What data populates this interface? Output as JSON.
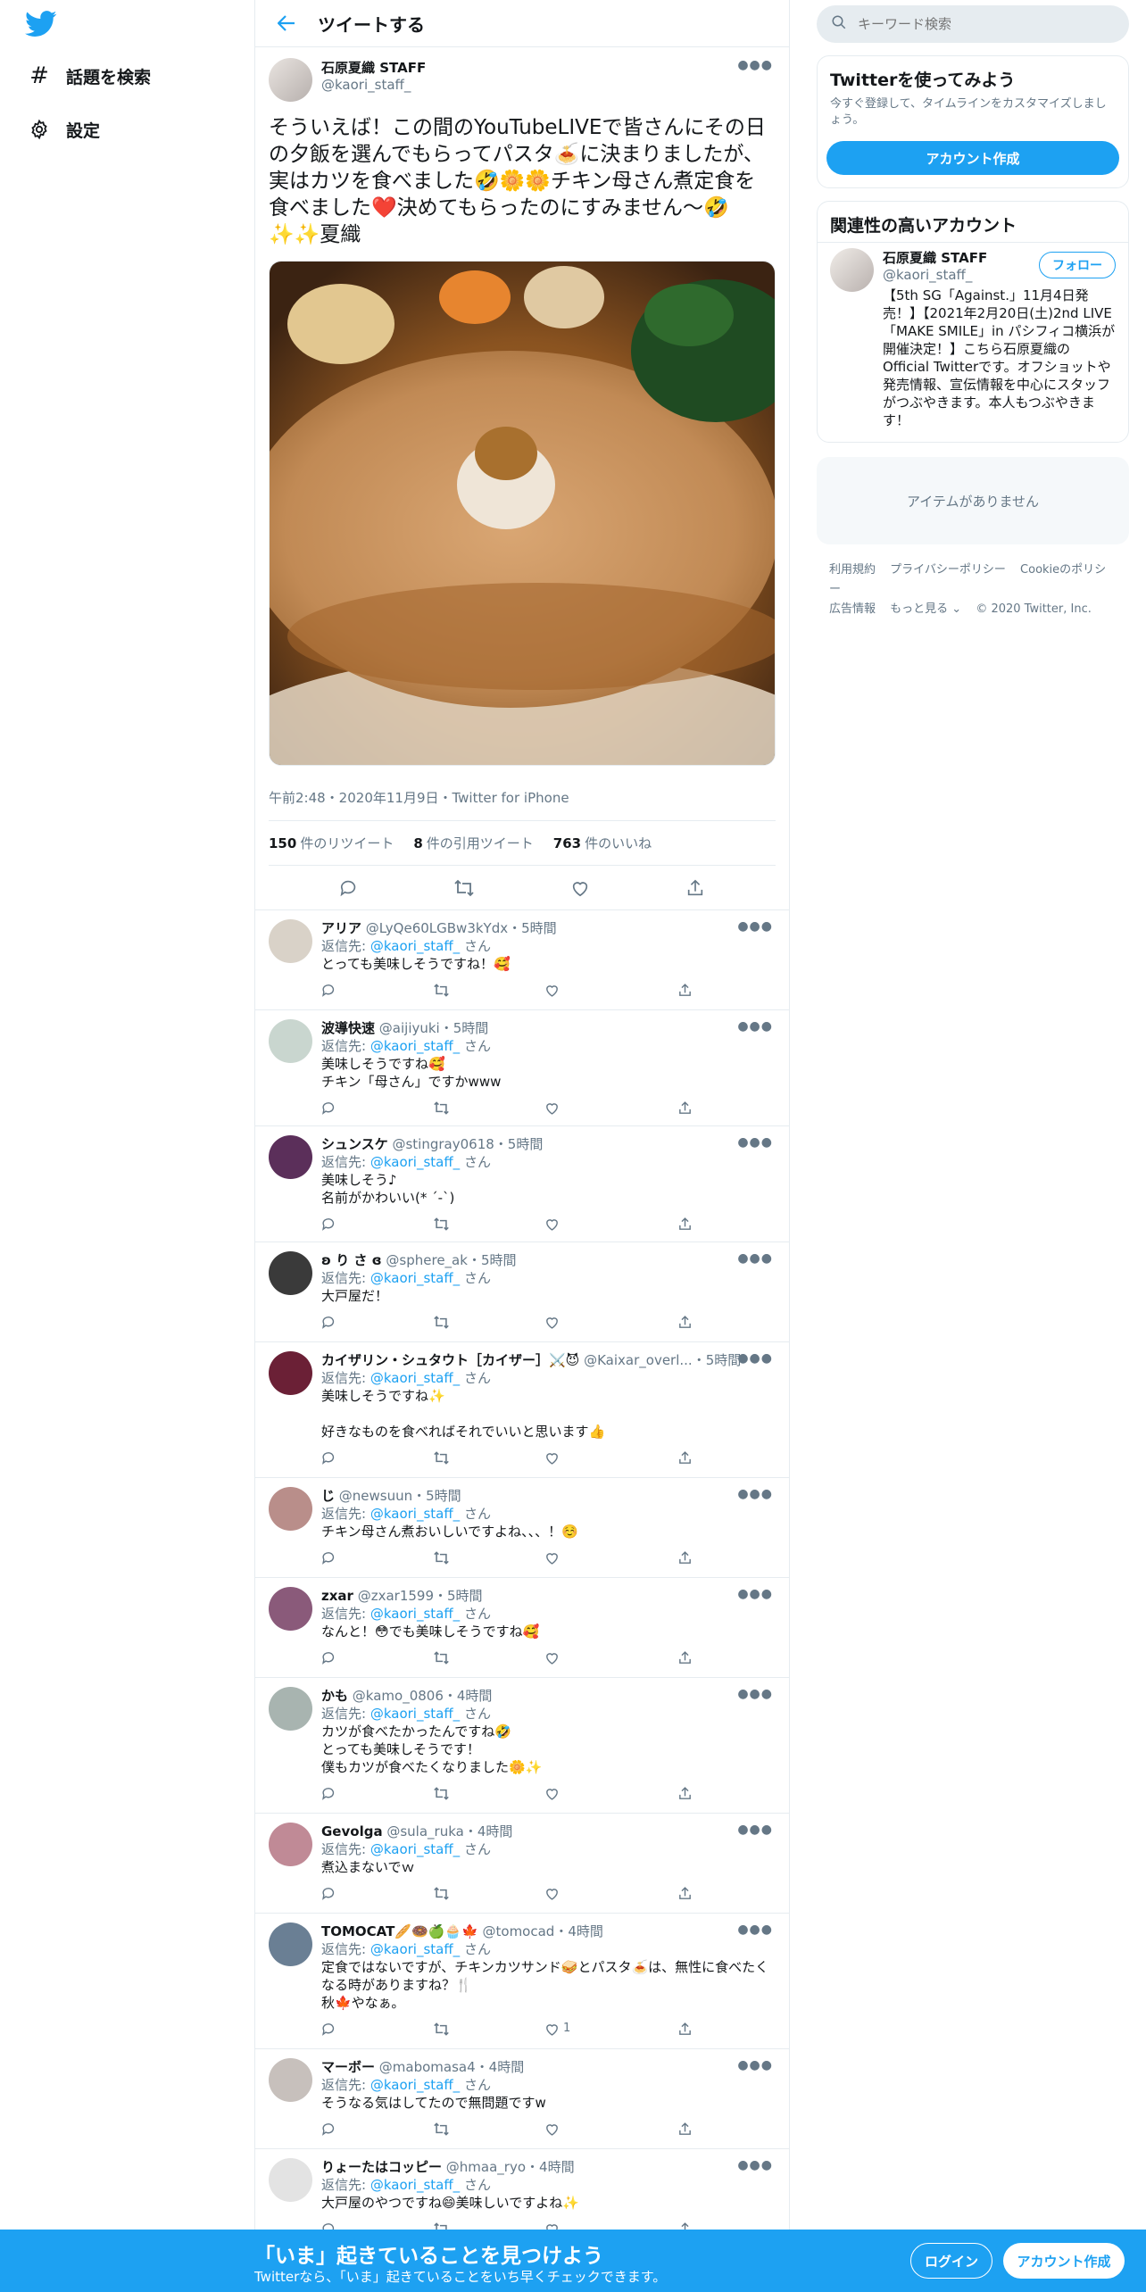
{
  "nav": {
    "items": [
      {
        "label": "話題を検索",
        "icon": "hashtag-icon"
      },
      {
        "label": "設定",
        "icon": "gear-icon"
      }
    ]
  },
  "header": {
    "title": "ツイートする"
  },
  "tweet": {
    "display_name": "石原夏織 STAFF",
    "username": "@kaori_staff_",
    "text": "そういえば！この間のYouTubeLIVEで皆さんにその日の夕飯を選んでもらってパスタ🍝に決まりましたが、実はカツを食べました🤣🌼🌼チキン母さん煮定食を食べました❤️決めてもらったのにすみません〜🤣✨✨夏織",
    "meta": "午前2:48・2020年11月9日・Twitter for iPhone",
    "retweets": "150",
    "retweets_label": "件のリツイート",
    "quotes": "8",
    "quotes_label": "件の引用ツイート",
    "likes": "763",
    "likes_label": "件のいいね"
  },
  "reply_prefix": "返信先: ",
  "reply_suffix": " さん",
  "replies": [
    {
      "name": "アリア",
      "handle": "@LyQe60LGBw3kYdx",
      "time": "・5時間",
      "to": "@kaori_staff_",
      "text": "とっても美味しそうですね！🥰",
      "likes": "",
      "avatar": "#d9d2c8"
    },
    {
      "name": "波導快速",
      "handle": "@aijiyuki",
      "time": "・5時間",
      "to": "@kaori_staff_",
      "text": "美味しそうですね🥰\nチキン「母さん」ですかwww",
      "likes": "",
      "avatar": "#c9d6cf"
    },
    {
      "name": "シュンスケ",
      "handle": "@stingray0618",
      "time": "・5時間",
      "to": "@kaori_staff_",
      "text": "美味しそう♪\n名前がかわいい(* ´-`)",
      "likes": "",
      "avatar": "#5b2f5a"
    },
    {
      "name": "ʚ り さ ɞ",
      "handle": "@sphere_ak",
      "time": "・5時間",
      "to": "@kaori_staff_",
      "text": "大戸屋だ！",
      "likes": "",
      "avatar": "#3a3a3a"
    },
    {
      "name": "カイザリン・シュタウト［カイザー］⚔️😈",
      "handle": "@Kaixar_overl...",
      "time": "・5時間",
      "to": "@kaori_staff_",
      "text": "美味しそうですね✨\n\n好きなものを食べればそれでいいと思います👍",
      "likes": "",
      "avatar": "#6b2036"
    },
    {
      "name": "じ",
      "handle": "@newsuun",
      "time": "・5時間",
      "to": "@kaori_staff_",
      "text": "チキン母さん煮おいしいですよね、、、！☺️",
      "likes": "",
      "avatar": "#b98e8a"
    },
    {
      "name": "zxar",
      "handle": "@zxar1599",
      "time": "・5時間",
      "to": "@kaori_staff_",
      "text": "なんと！😳でも美味しそうですね🥰",
      "likes": "",
      "avatar": "#8a5a7a"
    },
    {
      "name": "かも",
      "handle": "@kamo_0806",
      "time": "・4時間",
      "to": "@kaori_staff_",
      "text": "カツが食べたかったんですね🤣\nとっても美味しそうです！\n僕もカツが食べたくなりました🌼✨",
      "likes": "",
      "avatar": "#a8b4b0"
    },
    {
      "name": "Gevolga",
      "handle": "@sula_ruka",
      "time": "・4時間",
      "to": "@kaori_staff_",
      "text": "煮込まないでｗ",
      "likes": "",
      "avatar": "#c08a96"
    },
    {
      "name": "TOMOCAT🥖🍩🍏🧁🍁",
      "handle": "@tomocad",
      "time": "・4時間",
      "to": "@kaori_staff_",
      "text": "定食ではないですが、チキンカツサンド🥪とパスタ🍝は、無性に食べたくなる時がありますね？🍴\n秋🍁やなぁ。",
      "likes": "1",
      "avatar": "#6a7f94"
    },
    {
      "name": "マーボー",
      "handle": "@mabomasa4",
      "time": "・4時間",
      "to": "@kaori_staff_",
      "text": "そうなる気はしてたので無問題ですw",
      "likes": "",
      "avatar": "#c7c0bc"
    },
    {
      "name": "りょーたはコッピー",
      "handle": "@hmaa_ryo",
      "time": "・4時間",
      "to": "@kaori_staff_",
      "text": "大戸屋のやつですね😄美味しいですよね✨",
      "likes": "",
      "avatar": "#e3e3e3"
    }
  ],
  "right": {
    "search_placeholder": "キーワード検索",
    "signup_card": {
      "title": "Twitterを使ってみよう",
      "subtitle": "今すぐ登録して、タイムラインをカスタマイズしましょう。",
      "button": "アカウント作成"
    },
    "related": {
      "title": "関連性の高いアカウント",
      "name": "石原夏織 STAFF",
      "handle": "@kaori_staff_",
      "follow": "フォロー",
      "bio": "【5th SG「Against.」11月4日発売！】【2021年2月20日(土)2nd LIVE「MAKE SMILE」in パシフィコ横浜が開催決定！】こちら石原夏織のOfficial Twitterです。オフショットや発売情報、宣伝情報を中心にスタッフがつぶやきます。本人もつぶやきます！"
    },
    "empty_text": "アイテムがありません",
    "footer": [
      "利用規約",
      "プライバシーポリシー",
      "Cookieのポリシー",
      "広告情報",
      "もっと見る ⌄",
      "© 2020 Twitter, Inc."
    ]
  },
  "bottombar": {
    "headline": "「いま」起きていることを見つけよう",
    "sub": "Twitterなら、「いま」起きていることをいち早くチェックできます。",
    "login": "ログイン",
    "signup": "アカウント作成"
  },
  "colors": {
    "accent": "#1da1f2",
    "text": "#14171a",
    "secondary": "#657786",
    "border": "#e6ecf0"
  }
}
